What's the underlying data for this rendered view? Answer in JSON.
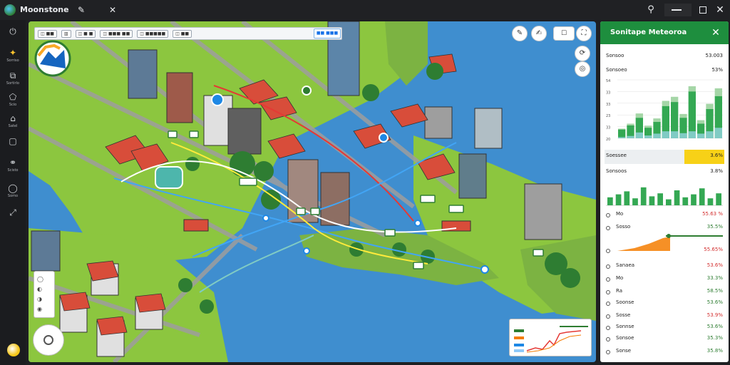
{
  "window": {
    "title": "Moonstone",
    "pin_glyph": "✎",
    "tools_glyph": "✕"
  },
  "sidebar": {
    "items": [
      {
        "icon": "power-icon",
        "glyph": "⏻",
        "label": ""
      },
      {
        "icon": "layers-icon",
        "glyph": "✦",
        "label": "Sorriso",
        "active": true
      },
      {
        "icon": "export-icon",
        "glyph": "⧉",
        "label": "Sortirlo"
      },
      {
        "icon": "tag-icon",
        "glyph": "⬠",
        "label": "Scio"
      },
      {
        "icon": "home-icon",
        "glyph": "⌂",
        "label": "Satel"
      },
      {
        "icon": "square-icon",
        "glyph": "▢",
        "label": ""
      },
      {
        "icon": "link-icon",
        "glyph": "⚭",
        "label": "Scisto"
      },
      {
        "icon": "globe-icon",
        "glyph": "◯",
        "label": "Somo"
      },
      {
        "icon": "share-icon",
        "glyph": "⤢",
        "label": ""
      }
    ]
  },
  "map": {
    "toolbar_chips": [
      "◫ ■■",
      "▥",
      "◫ ■ ■",
      "◫ ■■■ ■■",
      "◫ ■■■■■",
      "◫ ■■"
    ],
    "search_chip": "■■ ■■■",
    "controls": [
      "✎",
      "✍",
      "☐",
      "⛶",
      "⟳",
      "◎"
    ],
    "legend_glyphs": [
      "◯",
      "◐",
      "◑",
      "◉"
    ],
    "route_colors": [
      "#ffffff",
      "#e53935",
      "#42a5f5",
      "#ffeb3b",
      "#80cbc4"
    ]
  },
  "panel": {
    "title": "Sonitape Meteoroa",
    "rows_top": [
      {
        "k": "Sonsoo",
        "v": "53.003"
      },
      {
        "k": "Sonsoeo",
        "v": "53%"
      }
    ],
    "chart1": {
      "ylabels": [
        "54",
        "33",
        "33",
        "23",
        "33",
        "20"
      ],
      "values": [
        0.15,
        0.22,
        0.35,
        0.18,
        0.28,
        0.55,
        0.62,
        0.35,
        0.8,
        0.25,
        0.5,
        0.72
      ],
      "light_values": [
        0.05,
        0.1,
        0.25,
        0.12,
        0.2,
        0.3,
        0.3,
        0.22,
        0.3,
        0.2,
        0.3,
        0.45
      ]
    },
    "highlight": {
      "k": "Soessee",
      "v": "3.6%"
    },
    "row_mid": {
      "k": "Sonsoos",
      "v": "3.8%"
    },
    "chart2": {
      "values": [
        0.4,
        0.55,
        0.7,
        0.35,
        0.9,
        0.45,
        0.6,
        0.3,
        0.75,
        0.4,
        0.55,
        0.85,
        0.35,
        0.6
      ]
    },
    "list": [
      {
        "k": "Mo",
        "v": "55.63 %",
        "color": "#d32f2f"
      },
      {
        "k": "Sosso",
        "v": "35.5%",
        "color": "#2e7d32"
      },
      {
        "k": "",
        "v": "55.65%",
        "color": "#d32f2f"
      },
      {
        "k": "Sanaea",
        "v": "53.6%",
        "color": "#d32f2f"
      },
      {
        "k": "Mo",
        "v": "33.3%",
        "color": "#2e7d32"
      },
      {
        "k": "Ra",
        "v": "58.5%",
        "color": "#2e7d32"
      },
      {
        "k": "Soonse",
        "v": "53.6%",
        "color": "#2e7d32"
      },
      {
        "k": "Sosse",
        "v": "53.9%",
        "color": "#d32f2f"
      },
      {
        "k": "Sonnse",
        "v": "53.6%",
        "color": "#2e7d32"
      },
      {
        "k": "Sonsoe",
        "v": "35.3%",
        "color": "#2e7d32"
      },
      {
        "k": "Sonse",
        "v": "35.8%",
        "color": "#2e7d32"
      }
    ]
  }
}
